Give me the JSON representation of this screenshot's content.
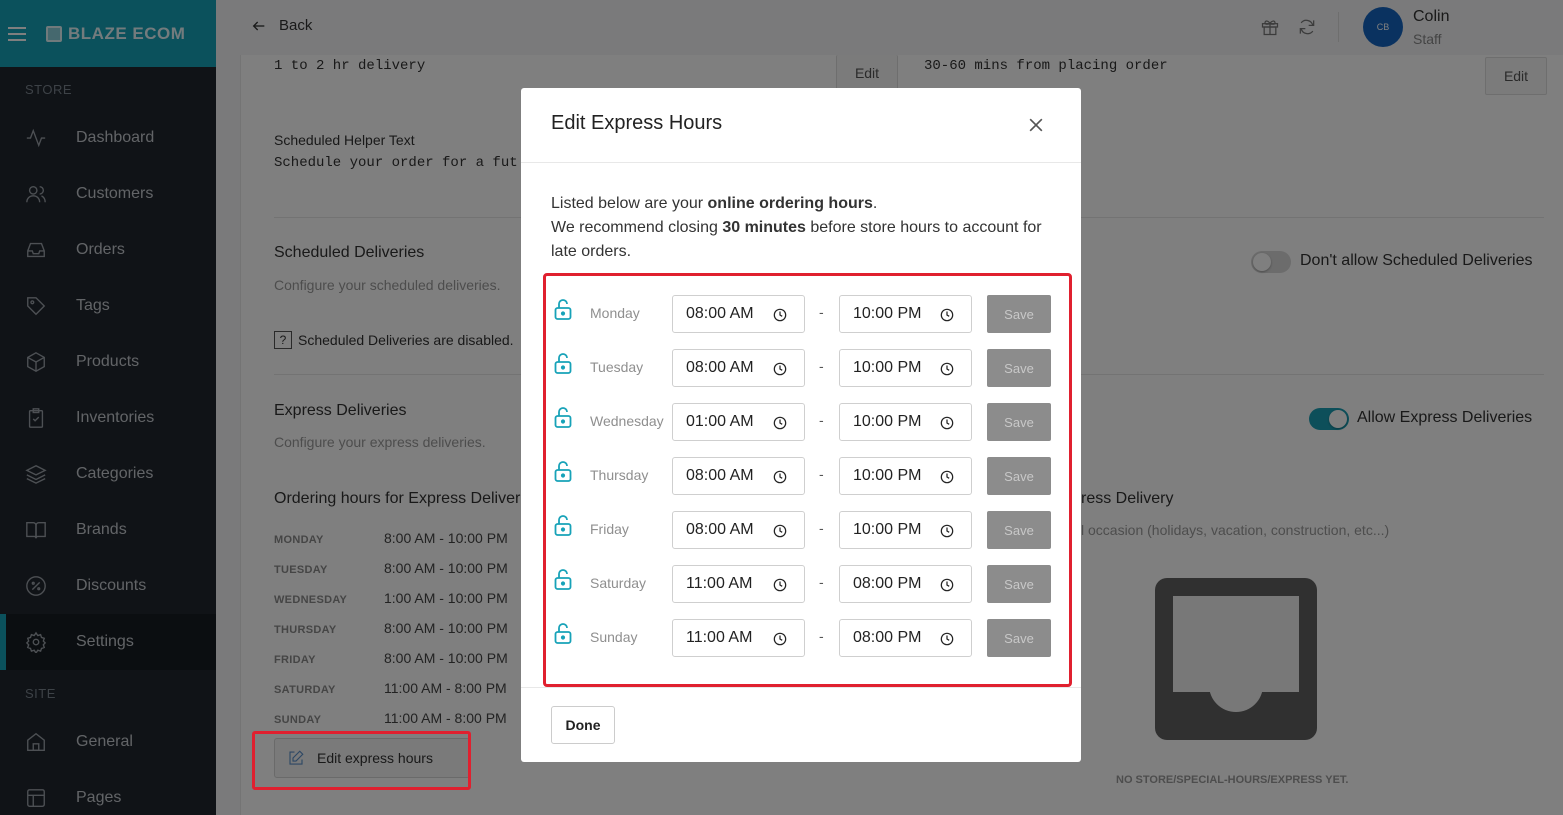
{
  "sidebar": {
    "brand": "BLAZE ECOM",
    "store_label": "STORE",
    "site_label": "SITE",
    "items": [
      {
        "label": "Dashboard",
        "icon": "activity-icon"
      },
      {
        "label": "Customers",
        "icon": "users-icon"
      },
      {
        "label": "Orders",
        "icon": "inbox-icon"
      },
      {
        "label": "Tags",
        "icon": "tag-icon"
      },
      {
        "label": "Products",
        "icon": "box-icon"
      },
      {
        "label": "Inventories",
        "icon": "clipboard-icon"
      },
      {
        "label": "Categories",
        "icon": "layers-icon"
      },
      {
        "label": "Brands",
        "icon": "book-icon"
      },
      {
        "label": "Discounts",
        "icon": "percent-icon"
      },
      {
        "label": "Settings",
        "icon": "gear-icon"
      },
      {
        "label": "General",
        "icon": "home-icon"
      },
      {
        "label": "Pages",
        "icon": "layout-icon"
      }
    ]
  },
  "topbar": {
    "back_label": "Back",
    "avatar_initials": "CB",
    "user_name": "Colin",
    "user_role": "Staff"
  },
  "content": {
    "delivery_text_1": "1 to 2 hr delivery",
    "delivery_text_2": "30-60 mins from placing order",
    "edit_label": "Edit",
    "scheduled_helper_label": "Scheduled Helper Text",
    "scheduled_helper_value": "Schedule your order for a fut",
    "scheduled_title": "Scheduled Deliveries",
    "scheduled_sub": "Configure your scheduled deliveries.",
    "scheduled_toggle_label": "Don't allow Scheduled Deliveries",
    "scheduled_disabled_icon_text": "?",
    "scheduled_disabled_text": "Scheduled Deliveries are disabled.",
    "express_title": "Express Deliveries",
    "express_sub": "Configure your express deliveries.",
    "express_toggle_label": "Allow Express Deliveries",
    "ordering_hours_title": "Ordering hours for Express Deliver",
    "hours": [
      {
        "day": "MONDAY",
        "value": "8:00 AM - 10:00 PM"
      },
      {
        "day": "TUESDAY",
        "value": "8:00 AM - 10:00 PM"
      },
      {
        "day": "WEDNESDAY",
        "value": "1:00 AM - 10:00 PM"
      },
      {
        "day": "THURSDAY",
        "value": "8:00 AM - 10:00 PM"
      },
      {
        "day": "FRIDAY",
        "value": "8:00 AM - 10:00 PM"
      },
      {
        "day": "SATURDAY",
        "value": "11:00 AM - 8:00 PM"
      },
      {
        "day": "SUNDAY",
        "value": "11:00 AM - 8:00 PM"
      }
    ],
    "edit_hours_label": "Edit express hours",
    "special_title": "ress Delivery",
    "special_sub": "l occasion (holidays, vacation, construction, etc...)",
    "empty_text": "NO STORE/SPECIAL-HOURS/EXPRESS YET."
  },
  "modal": {
    "title": "Edit Express Hours",
    "desc_1a": "Listed below are your ",
    "desc_1b": "online ordering hours",
    "desc_1c": ".",
    "desc_2a": "We recommend closing ",
    "desc_2b": "30 minutes",
    "desc_2c": " before store hours to account for late orders.",
    "dash": "-",
    "save_label": "Save",
    "done_label": "Done",
    "days": [
      {
        "name": "Monday",
        "open": "08:00 AM",
        "close": "10:00 PM"
      },
      {
        "name": "Tuesday",
        "open": "08:00 AM",
        "close": "10:00 PM"
      },
      {
        "name": "Wednesday",
        "open": "01:00 AM",
        "close": "10:00 PM"
      },
      {
        "name": "Thursday",
        "open": "08:00 AM",
        "close": "10:00 PM"
      },
      {
        "name": "Friday",
        "open": "08:00 AM",
        "close": "10:00 PM"
      },
      {
        "name": "Saturday",
        "open": "11:00 AM",
        "close": "08:00 PM"
      },
      {
        "name": "Sunday",
        "open": "11:00 AM",
        "close": "08:00 PM"
      }
    ]
  },
  "colors": {
    "accent": "#17a2b8",
    "sidebar_bg": "#20262e",
    "highlight": "#e0202f",
    "toggle_on": "#1a9fb5"
  }
}
